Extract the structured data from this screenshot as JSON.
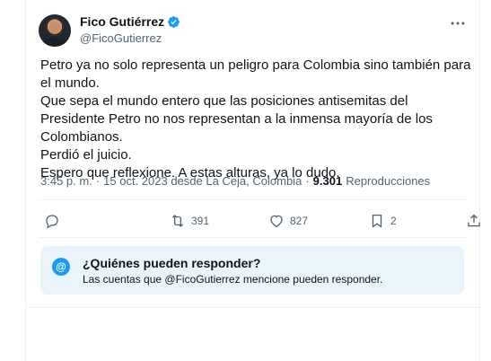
{
  "author": {
    "display_name": "Fico Gutiérrez",
    "handle": "@FicoGutierrez"
  },
  "tweet": {
    "lines": [
      "Petro ya no solo representa un peligro para Colombia sino también para el mundo.",
      "Que sepa el mundo entero que las posiciones antisemitas del Presidente Petro no nos representan a la inmensa mayoría de los Colombianos.",
      "Perdió el juicio.",
      "Espero que reflexione. A estas alturas, ya lo dudo."
    ]
  },
  "meta": {
    "time": "3:45 p. m.",
    "separator": "·",
    "date_location": "15 oct. 2023 desde La Ceja, Colombia",
    "views_count": "9.301",
    "views_label": "Reproducciones"
  },
  "actions": {
    "reply_count": "",
    "retweet_count": "391",
    "like_count": "827",
    "bookmark_count": "2"
  },
  "reply_restriction": {
    "title": "¿Quiénes pueden responder?",
    "subtitle": "Las cuentas que @FicoGutierrez mencione pueden responder.",
    "icon_glyph": "@"
  },
  "colors": {
    "accent": "#1d9bf0",
    "muted": "#536471",
    "reply_box_bg": "#eaf4fb"
  }
}
